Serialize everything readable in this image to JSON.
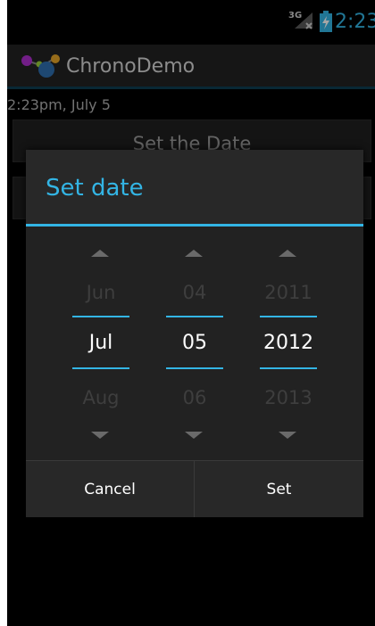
{
  "status_bar": {
    "network": "3G",
    "time": "2:23",
    "accent_color": "#33b5e5"
  },
  "action_bar": {
    "app_icon": "chrono-demo-app-icon",
    "title": "ChronoDemo"
  },
  "main": {
    "datetime_text": "2:23pm, July 5",
    "set_date_button": "Set the Date",
    "set_time_button": ""
  },
  "dialog": {
    "title": "Set date",
    "month": {
      "prev": "Jun",
      "current": "Jul",
      "next": "Aug"
    },
    "day": {
      "prev": "04",
      "current": "05",
      "next": "06"
    },
    "year": {
      "prev": "2011",
      "current": "2012",
      "next": "2013"
    },
    "cancel_label": "Cancel",
    "set_label": "Set",
    "accent_color": "#33b5e5"
  }
}
